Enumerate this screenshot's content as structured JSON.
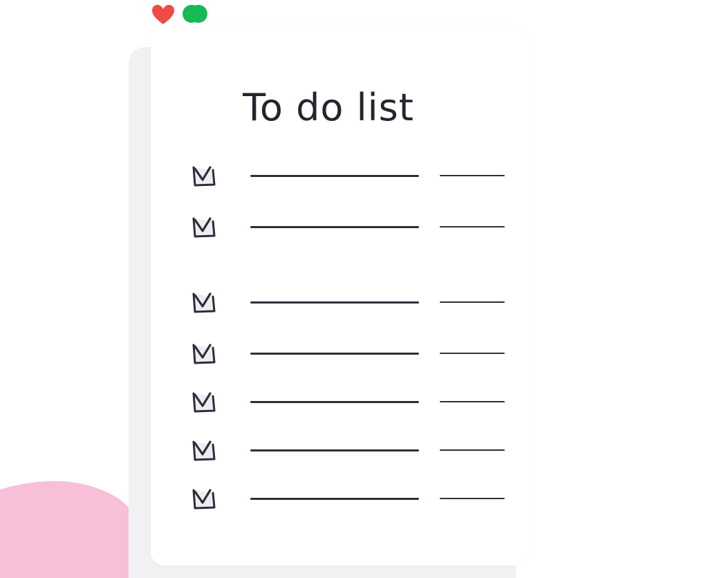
{
  "window": {
    "controls": [
      {
        "icon": "heart-icon",
        "color": "#ef4b45"
      },
      {
        "icon": "green-circle-icon",
        "color": "#18b957"
      }
    ]
  },
  "todo": {
    "title": "To do list",
    "tasks": [
      {
        "checked": true,
        "text": "",
        "date": ""
      },
      {
        "checked": true,
        "text": "",
        "date": ""
      },
      {
        "checked": true,
        "text": "",
        "date": ""
      },
      {
        "checked": true,
        "text": "",
        "date": ""
      },
      {
        "checked": true,
        "text": "",
        "date": ""
      },
      {
        "checked": true,
        "text": "",
        "date": ""
      },
      {
        "checked": true,
        "text": "",
        "date": ""
      }
    ]
  },
  "colors": {
    "ink": "#2c2f3a",
    "background_blob": "#f8bfd9",
    "sheet_back": "#f1f1f3",
    "paper": "#ffffff"
  }
}
